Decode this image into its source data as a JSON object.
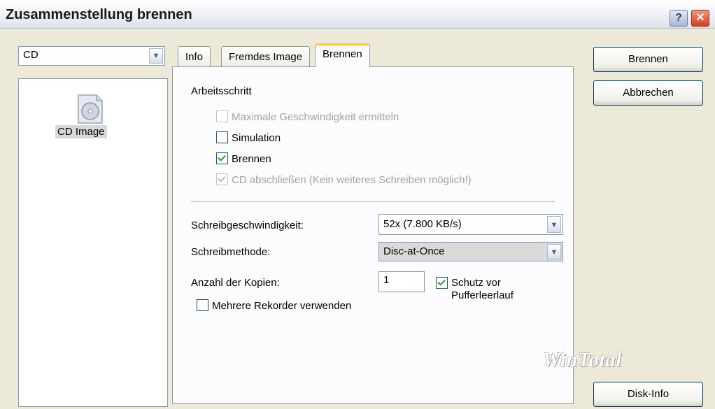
{
  "window": {
    "title": "Zusammenstellung brennen"
  },
  "media_select": {
    "value": "CD"
  },
  "compilation_list": {
    "items": [
      {
        "label": "CD Image",
        "icon": "cd-image-icon"
      }
    ]
  },
  "tabs": [
    {
      "label": "Info",
      "active": false
    },
    {
      "label": "Fremdes Image",
      "active": false
    },
    {
      "label": "Brennen",
      "active": true
    }
  ],
  "burn_tab": {
    "section_label": "Arbeitsschritt",
    "steps": [
      {
        "label": "Maximale Geschwindigkeit ermitteln",
        "checked": false,
        "enabled": false
      },
      {
        "label": "Simulation",
        "checked": false,
        "enabled": true
      },
      {
        "label": "Brennen",
        "checked": true,
        "enabled": true
      },
      {
        "label": "CD abschließen (Kein weiteres Schreiben möglich!)",
        "checked": true,
        "enabled": false
      }
    ],
    "write_speed": {
      "label": "Schreibgeschwindigkeit:",
      "value": "52x (7.800 KB/s)"
    },
    "write_method": {
      "label": "Schreibmethode:",
      "value": "Disc-at-Once"
    },
    "copies": {
      "label": "Anzahl der Kopien:",
      "value": "1"
    },
    "buffer_protection": {
      "label_line1": "Schutz vor",
      "label_line2": "Pufferleerlauf",
      "checked": true
    },
    "multiple_recorders": {
      "label": "Mehrere Rekorder verwenden",
      "checked": false
    }
  },
  "buttons": {
    "burn": "Brennen",
    "cancel": "Abbrechen",
    "disk_info": "Disk-Info"
  },
  "watermark": "WinTotal",
  "colors": {
    "active_tab_accent": "#ffc83c",
    "checkmark": "#21a121",
    "close_button": "#d2401f"
  }
}
